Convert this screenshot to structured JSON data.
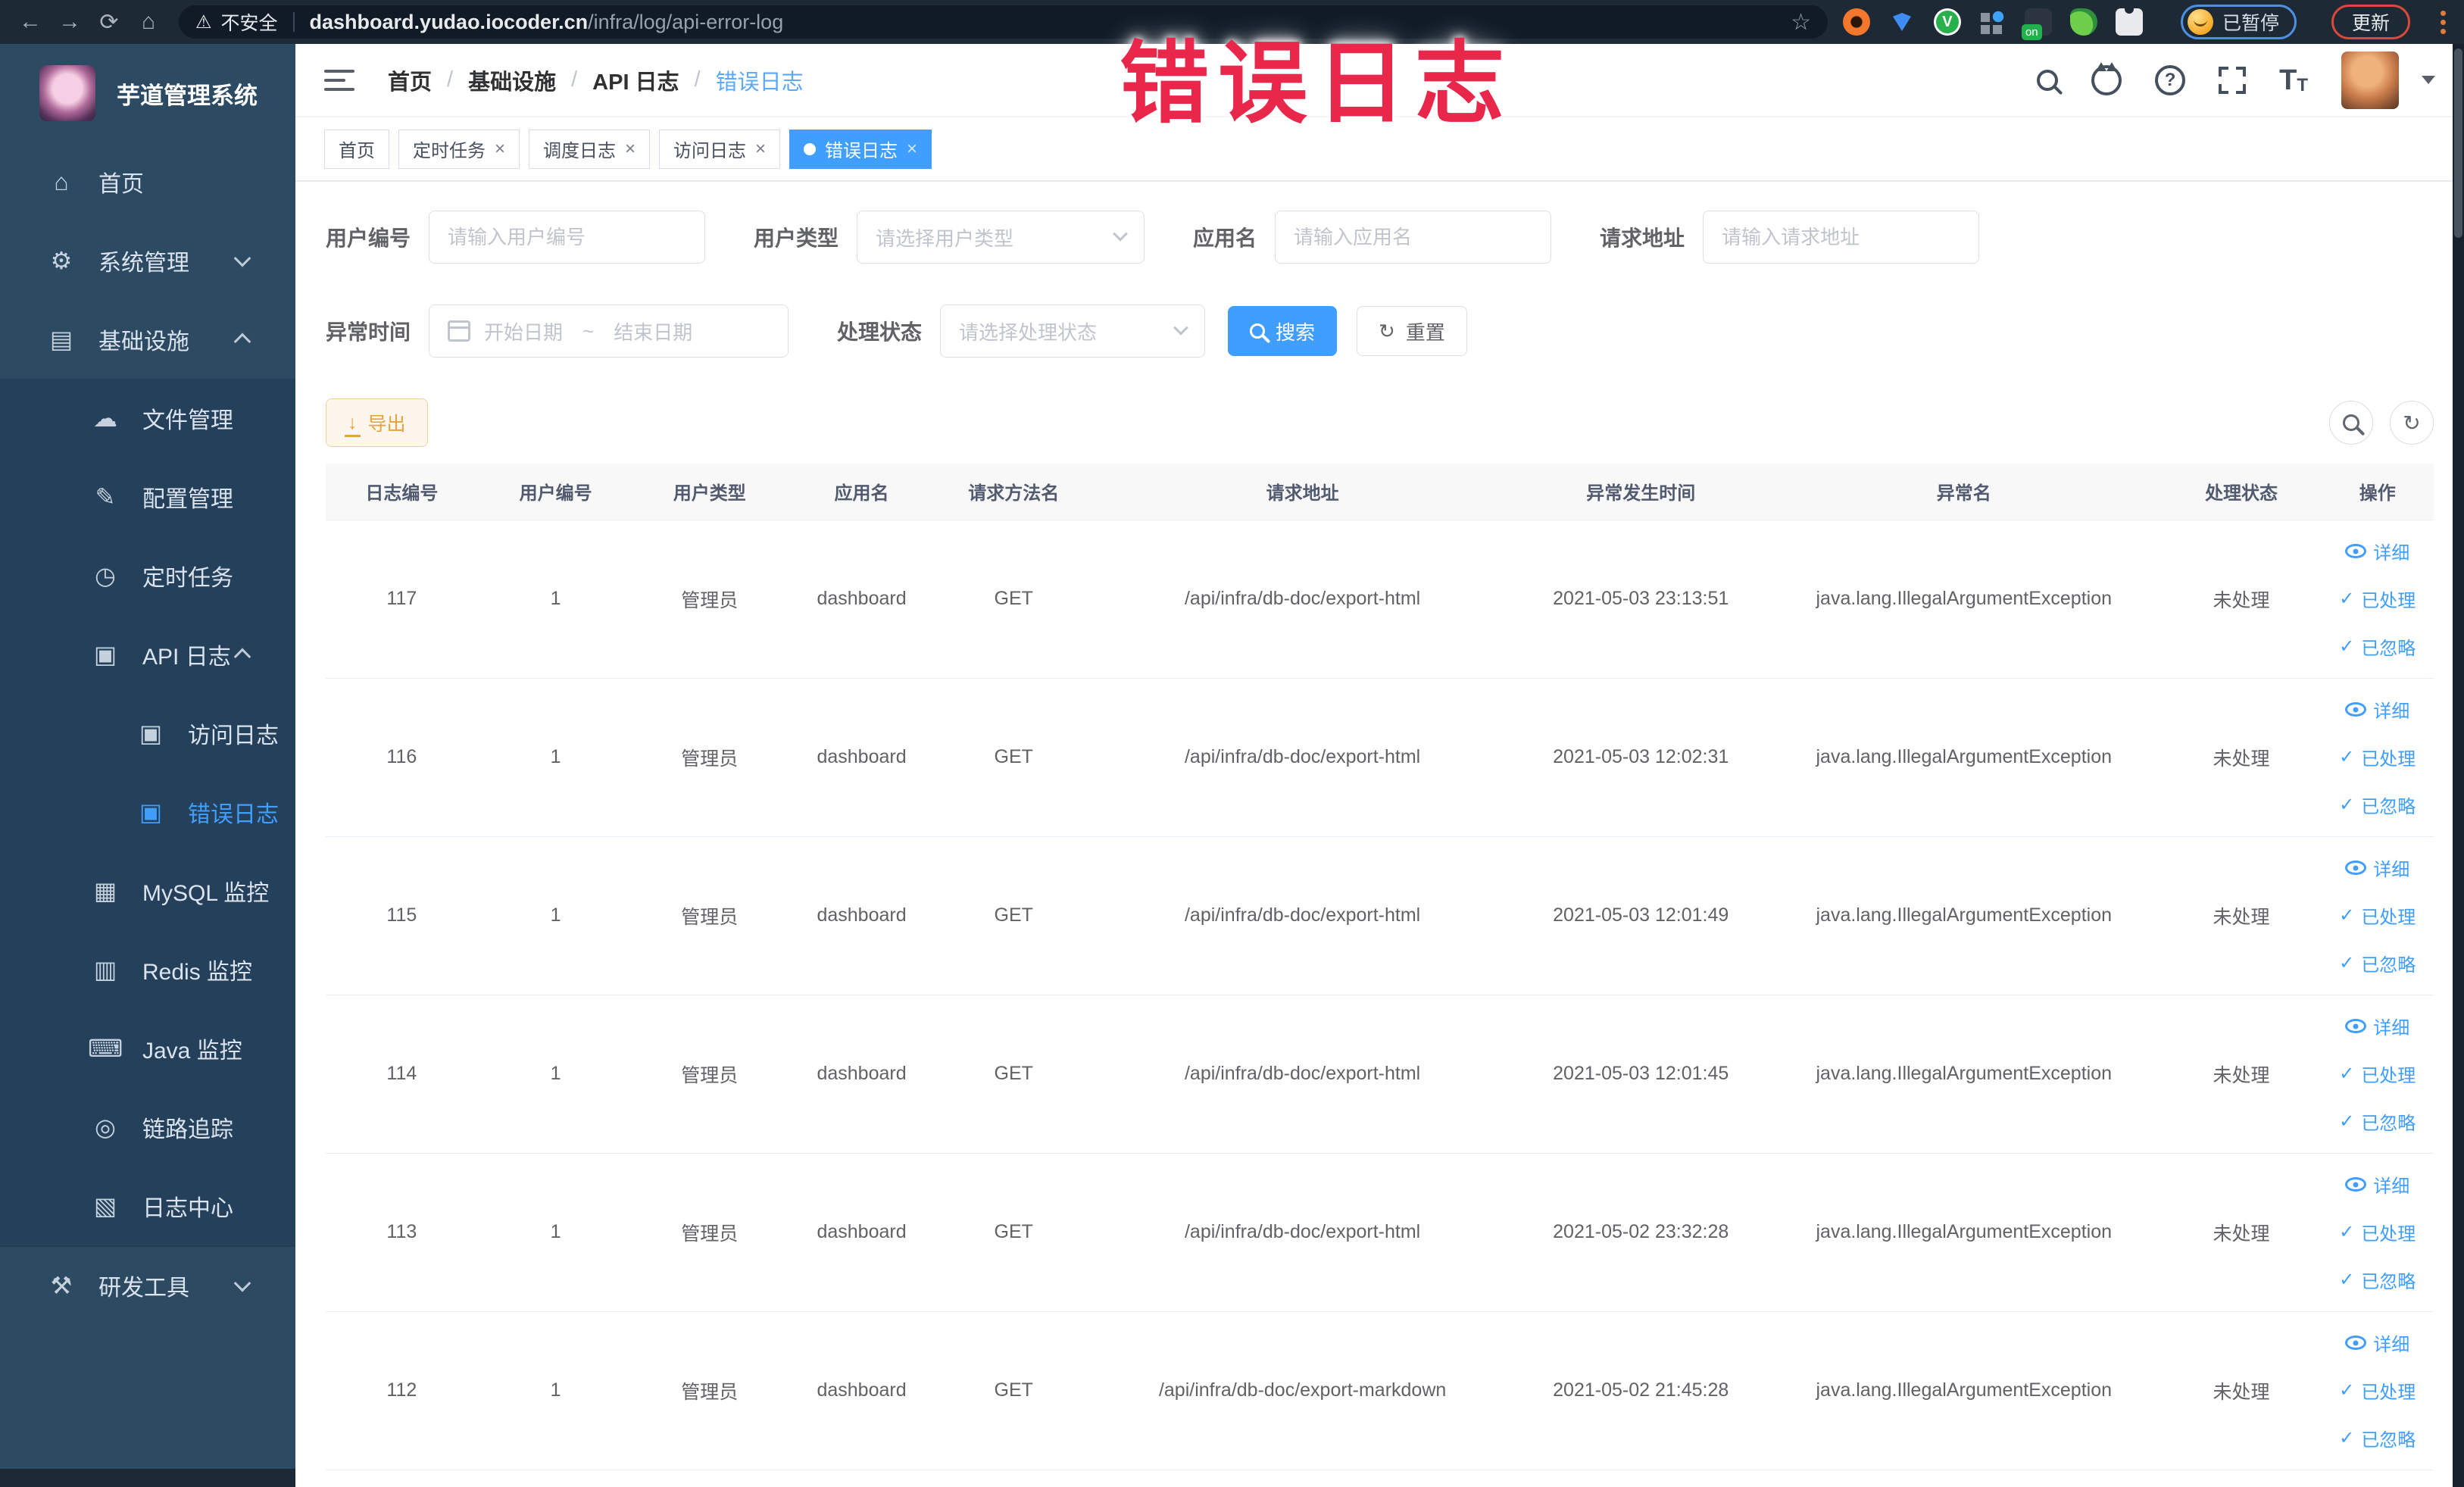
{
  "browser": {
    "security_text": "不安全",
    "url_host": "dashboard.yudao.iocoder.cn",
    "url_path": "/infra/log/api-error-log",
    "paused_label": "已暂停",
    "update_label": "更新",
    "nav_icons": [
      "back-icon",
      "forward-icon",
      "reload-icon",
      "home-icon"
    ],
    "extension_icons": [
      "bookmark-star-icon",
      "adblock-icon",
      "proxy-icon",
      "password-manager-icon",
      "tab-grid-icon",
      "switch-on-icon",
      "leaf-icon",
      "extensions-puzzle-icon"
    ]
  },
  "sidebar": {
    "title": "芋道管理系统",
    "items": [
      {
        "key": "home",
        "label": "首页",
        "icon": "home-icon",
        "glyph": "⌂",
        "level": 1,
        "sub": false
      },
      {
        "key": "system-management",
        "label": "系统管理",
        "icon": "gear-icon",
        "glyph": "⚙",
        "level": 1,
        "sub": false,
        "chevron": "down"
      },
      {
        "key": "infrastructure",
        "label": "基础设施",
        "icon": "infra-icon",
        "glyph": "▤",
        "level": 1,
        "sub": false,
        "chevron": "up"
      },
      {
        "key": "file-management",
        "label": "文件管理",
        "icon": "cloud-icon",
        "glyph": "☁",
        "level": 2,
        "sub": true
      },
      {
        "key": "config-management",
        "label": "配置管理",
        "icon": "edit-icon",
        "glyph": "✎",
        "level": 2,
        "sub": true
      },
      {
        "key": "scheduled-tasks",
        "label": "定时任务",
        "icon": "timer-icon",
        "glyph": "◷",
        "level": 2,
        "sub": true
      },
      {
        "key": "api-log",
        "label": "API 日志",
        "icon": "api-log-icon",
        "glyph": "▣",
        "level": 2,
        "sub": true,
        "chevron": "up"
      },
      {
        "key": "access-log",
        "label": "访问日志",
        "icon": "access-log-icon",
        "glyph": "▣",
        "level": 3,
        "sub": true
      },
      {
        "key": "error-log",
        "label": "错误日志",
        "icon": "error-log-icon",
        "glyph": "▣",
        "level": 3,
        "sub": true,
        "active": true
      },
      {
        "key": "mysql-monitor",
        "label": "MySQL 监控",
        "icon": "mysql-icon",
        "glyph": "▦",
        "level": 2,
        "sub": true
      },
      {
        "key": "redis-monitor",
        "label": "Redis 监控",
        "icon": "redis-icon",
        "glyph": "▥",
        "level": 2,
        "sub": true
      },
      {
        "key": "java-monitor",
        "label": "Java 监控",
        "icon": "java-icon",
        "glyph": "⌨",
        "level": 2,
        "sub": true
      },
      {
        "key": "tracing",
        "label": "链路追踪",
        "icon": "trace-eye-icon",
        "glyph": "◎",
        "level": 2,
        "sub": true
      },
      {
        "key": "log-center",
        "label": "日志中心",
        "icon": "log-center-icon",
        "glyph": "▧",
        "level": 2,
        "sub": true
      },
      {
        "key": "dev-tools",
        "label": "研发工具",
        "icon": "tools-icon",
        "glyph": "⚒",
        "level": 1,
        "sub": false,
        "chevron": "down",
        "separated": true
      }
    ]
  },
  "header": {
    "breadcrumb": [
      "首页",
      "基础设施",
      "API 日志",
      "错误日志"
    ],
    "separator": "/",
    "right_icons": [
      "search-icon",
      "github-icon",
      "help-icon",
      "fullscreen-icon",
      "font-size-icon",
      "avatar",
      "caret-down-icon"
    ]
  },
  "tabs": [
    {
      "label": "首页",
      "closable": false,
      "active": false
    },
    {
      "label": "定时任务",
      "closable": true,
      "active": false
    },
    {
      "label": "调度日志",
      "closable": true,
      "active": false
    },
    {
      "label": "访问日志",
      "closable": true,
      "active": false
    },
    {
      "label": "错误日志",
      "closable": true,
      "active": true
    }
  ],
  "filters": {
    "user_id": {
      "label": "用户编号",
      "placeholder": "请输入用户编号"
    },
    "user_type": {
      "label": "用户类型",
      "placeholder": "请选择用户类型"
    },
    "app_name": {
      "label": "应用名",
      "placeholder": "请输入应用名"
    },
    "request_url": {
      "label": "请求地址",
      "placeholder": "请输入请求地址"
    },
    "exception_time": {
      "label": "异常时间",
      "start_placeholder": "开始日期",
      "separator": "~",
      "end_placeholder": "结束日期"
    },
    "process_status": {
      "label": "处理状态",
      "placeholder": "请选择处理状态"
    },
    "search_label": "搜索",
    "reset_label": "重置"
  },
  "toolbar": {
    "export_label": "导出"
  },
  "table": {
    "headers": [
      "日志编号",
      "用户编号",
      "用户类型",
      "应用名",
      "请求方法名",
      "请求地址",
      "异常发生时间",
      "异常名",
      "处理状态",
      "操作"
    ],
    "rows": [
      {
        "id": "117",
        "user_id": "1",
        "user_type": "管理员",
        "app_name": "dashboard",
        "method": "GET",
        "url": "/api/infra/db-doc/export-html",
        "time": "2021-05-03 23:13:51",
        "exception": "java.lang.IllegalArgumentException",
        "status": "未处理",
        "actions": [
          "详细",
          "已处理",
          "已忽略"
        ]
      },
      {
        "id": "116",
        "user_id": "1",
        "user_type": "管理员",
        "app_name": "dashboard",
        "method": "GET",
        "url": "/api/infra/db-doc/export-html",
        "time": "2021-05-03 12:02:31",
        "exception": "java.lang.IllegalArgumentException",
        "status": "未处理",
        "actions": [
          "详细",
          "已处理",
          "已忽略"
        ]
      },
      {
        "id": "115",
        "user_id": "1",
        "user_type": "管理员",
        "app_name": "dashboard",
        "method": "GET",
        "url": "/api/infra/db-doc/export-html",
        "time": "2021-05-03 12:01:49",
        "exception": "java.lang.IllegalArgumentException",
        "status": "未处理",
        "actions": [
          "详细",
          "已处理",
          "已忽略"
        ]
      },
      {
        "id": "114",
        "user_id": "1",
        "user_type": "管理员",
        "app_name": "dashboard",
        "method": "GET",
        "url": "/api/infra/db-doc/export-html",
        "time": "2021-05-03 12:01:45",
        "exception": "java.lang.IllegalArgumentException",
        "status": "未处理",
        "actions": [
          "详细",
          "已处理",
          "已忽略"
        ]
      },
      {
        "id": "113",
        "user_id": "1",
        "user_type": "管理员",
        "app_name": "dashboard",
        "method": "GET",
        "url": "/api/infra/db-doc/export-html",
        "time": "2021-05-02 23:32:28",
        "exception": "java.lang.IllegalArgumentException",
        "status": "未处理",
        "actions": [
          "详细",
          "已处理",
          "已忽略"
        ]
      },
      {
        "id": "112",
        "user_id": "1",
        "user_type": "管理员",
        "app_name": "dashboard",
        "method": "GET",
        "url": "/api/infra/db-doc/export-markdown",
        "time": "2021-05-02 21:45:28",
        "exception": "java.lang.IllegalArgumentException",
        "status": "未处理",
        "actions": [
          "详细",
          "已处理",
          "已忽略"
        ]
      }
    ]
  },
  "overlay": {
    "text": "错误日志"
  },
  "colors": {
    "accent": "#409eff",
    "warning": "#e6a23c",
    "annotation": "#e8274b",
    "sidebar_bg": "#2d4a63",
    "submenu_bg": "#24405a"
  }
}
